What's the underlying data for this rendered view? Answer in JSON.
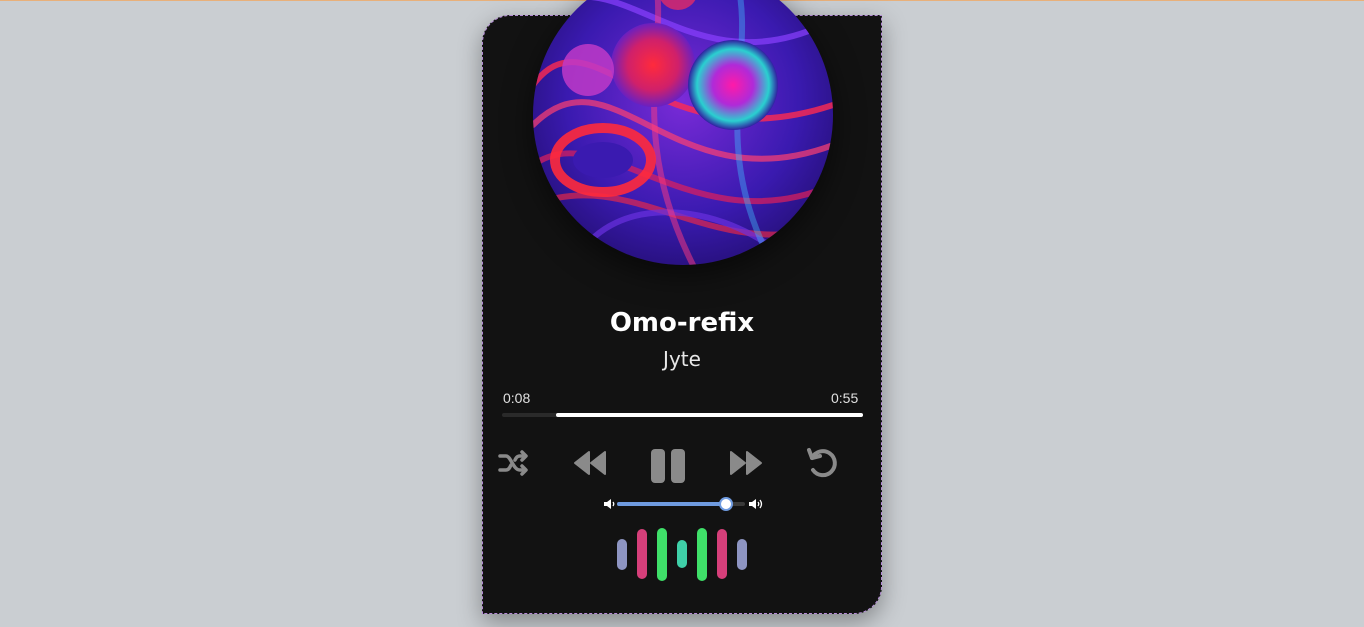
{
  "track": {
    "title": "Omo-refix",
    "artist": "Jyte",
    "current_time": "0:08",
    "duration": "0:55",
    "progress_fraction": 0.15
  },
  "controls": {
    "shuffle_icon": "shuffle-icon",
    "rewind_icon": "rewind-icon",
    "pause_icon": "pause-icon",
    "forward_icon": "fast-forward-icon",
    "repeat_icon": "repeat-icon",
    "icon_color": "#8a8a8a"
  },
  "volume": {
    "level_fraction": 0.85,
    "low_icon": "volume-low-icon",
    "high_icon": "volume-high-icon",
    "accent": "#6f9be0"
  },
  "visualizer": {
    "bars": [
      {
        "level": 0.55,
        "color": "#8e95c2"
      },
      {
        "level": 0.9,
        "color": "#d63f7a"
      },
      {
        "level": 0.95,
        "color": "#3fe069"
      },
      {
        "level": 0.5,
        "color": "#3fd0a8"
      },
      {
        "level": 0.95,
        "color": "#3fe069"
      },
      {
        "level": 0.9,
        "color": "#d63f7a"
      },
      {
        "level": 0.55,
        "color": "#8e95c2"
      }
    ]
  },
  "colors": {
    "background": "#caced2",
    "card": "#121212"
  }
}
